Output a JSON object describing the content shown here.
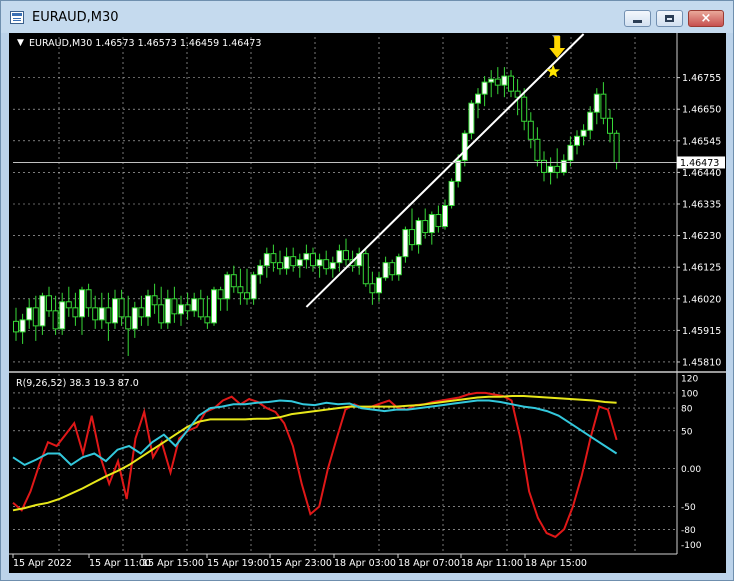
{
  "window": {
    "title": "EURAUD,M30",
    "buttons": {
      "minimize": "minimize-button",
      "maximize": "maximize-button",
      "close": "×"
    }
  },
  "chart_header": {
    "text": "EURAUD,M30  1.46573 1.46573 1.46459 1.46473",
    "dropdown_glyph": "▼"
  },
  "colors": {
    "background": "#000000",
    "grid": "#c8c8c8",
    "bull_candle": "#ffffff",
    "wick": "#38d838",
    "bid_line": "#c0c0c0",
    "trendline": "#ffffff",
    "arrow": "#ffd700",
    "star": "#ffe600",
    "line_red": "#e01818",
    "line_yellow": "#e8e81a",
    "line_cyan": "#33c8dc"
  },
  "price_axis": {
    "labels": [
      "1.46755",
      "1.46650",
      "1.46545",
      "1.46440",
      "1.46335",
      "1.46230",
      "1.46125",
      "1.46020",
      "1.45915",
      "1.45810"
    ],
    "current_price": "1.46473",
    "range": [
      1.4578,
      1.4689
    ]
  },
  "indicator": {
    "label": "R(9,26,52) 38.3 19.3 87.0",
    "axis_labels": [
      "120",
      "100",
      "80",
      "50",
      "0.00",
      "-50",
      "-80",
      "-100"
    ],
    "range": [
      -110,
      125
    ]
  },
  "time_axis": {
    "labels": [
      "15 Apr 2022",
      "15 Apr 11:00",
      "15 Apr 15:00",
      "15 Apr 19:00",
      "15 Apr 23:00",
      "18 Apr 03:00",
      "18 Apr 07:00",
      "18 Apr 11:00",
      "18 Apr 15:00"
    ]
  },
  "chart_data": {
    "type": "candlestick",
    "symbol": "EURAUD",
    "timeframe": "M30",
    "candles": [
      [
        1.45945,
        1.4599,
        1.4588,
        1.4591
      ],
      [
        1.4591,
        1.4597,
        1.4587,
        1.4595
      ],
      [
        1.4595,
        1.4602,
        1.4592,
        1.4599
      ],
      [
        1.4599,
        1.4603,
        1.4588,
        1.4593
      ],
      [
        1.4593,
        1.4604,
        1.459,
        1.4603
      ],
      [
        1.4603,
        1.4606,
        1.4596,
        1.4598
      ],
      [
        1.4598,
        1.4603,
        1.459,
        1.4592
      ],
      [
        1.4592,
        1.4604,
        1.459,
        1.4601
      ],
      [
        1.4601,
        1.4606,
        1.4596,
        1.4599
      ],
      [
        1.4599,
        1.4604,
        1.4593,
        1.4596
      ],
      [
        1.4596,
        1.4606,
        1.459,
        1.4605
      ],
      [
        1.4605,
        1.4607,
        1.4596,
        1.4599
      ],
      [
        1.4599,
        1.4603,
        1.4592,
        1.4595
      ],
      [
        1.4595,
        1.4604,
        1.4592,
        1.4599
      ],
      [
        1.4599,
        1.4604,
        1.4588,
        1.4594
      ],
      [
        1.4594,
        1.4605,
        1.4592,
        1.4602
      ],
      [
        1.4602,
        1.4605,
        1.4593,
        1.4596
      ],
      [
        1.4596,
        1.4603,
        1.4583,
        1.4592
      ],
      [
        1.4592,
        1.4601,
        1.4589,
        1.4599
      ],
      [
        1.4599,
        1.4603,
        1.4593,
        1.4596
      ],
      [
        1.4596,
        1.4605,
        1.4593,
        1.4603
      ],
      [
        1.4603,
        1.4607,
        1.4597,
        1.46
      ],
      [
        1.46,
        1.4606,
        1.4592,
        1.4594
      ],
      [
        1.4594,
        1.4605,
        1.4592,
        1.4602
      ],
      [
        1.4602,
        1.4606,
        1.4594,
        1.4597
      ],
      [
        1.4597,
        1.4603,
        1.4593,
        1.46
      ],
      [
        1.46,
        1.4604,
        1.4595,
        1.4598
      ],
      [
        1.4598,
        1.4604,
        1.4596,
        1.4602
      ],
      [
        1.4602,
        1.4605,
        1.4595,
        1.4596
      ],
      [
        1.4596,
        1.4603,
        1.4592,
        1.4594
      ],
      [
        1.4594,
        1.4606,
        1.4593,
        1.4605
      ],
      [
        1.4605,
        1.4606,
        1.4598,
        1.4602
      ],
      [
        1.4602,
        1.4611,
        1.4598,
        1.461
      ],
      [
        1.461,
        1.4613,
        1.4604,
        1.4606
      ],
      [
        1.4606,
        1.4612,
        1.46,
        1.4604
      ],
      [
        1.4604,
        1.4612,
        1.46,
        1.4602
      ],
      [
        1.4602,
        1.4611,
        1.46,
        1.461
      ],
      [
        1.461,
        1.4615,
        1.4607,
        1.4613
      ],
      [
        1.4613,
        1.4619,
        1.4609,
        1.4617
      ],
      [
        1.4617,
        1.462,
        1.4611,
        1.4614
      ],
      [
        1.4614,
        1.4618,
        1.461,
        1.4612
      ],
      [
        1.4612,
        1.4619,
        1.461,
        1.4616
      ],
      [
        1.4616,
        1.4619,
        1.4611,
        1.4613
      ],
      [
        1.4613,
        1.4617,
        1.4609,
        1.4615
      ],
      [
        1.4615,
        1.462,
        1.4612,
        1.4617
      ],
      [
        1.4617,
        1.4619,
        1.4611,
        1.4613
      ],
      [
        1.4613,
        1.4617,
        1.4609,
        1.4615
      ],
      [
        1.4615,
        1.4618,
        1.461,
        1.4612
      ],
      [
        1.4612,
        1.4616,
        1.4609,
        1.4614
      ],
      [
        1.4614,
        1.462,
        1.4611,
        1.4618
      ],
      [
        1.4618,
        1.4622,
        1.4613,
        1.4615
      ],
      [
        1.4615,
        1.4618,
        1.4611,
        1.4613
      ],
      [
        1.4613,
        1.4619,
        1.461,
        1.4617
      ],
      [
        1.4617,
        1.4619,
        1.4606,
        1.4607
      ],
      [
        1.4607,
        1.4611,
        1.46,
        1.4604
      ],
      [
        1.4604,
        1.4611,
        1.4601,
        1.4609
      ],
      [
        1.4609,
        1.4616,
        1.4608,
        1.4614
      ],
      [
        1.4614,
        1.4615,
        1.4608,
        1.461
      ],
      [
        1.461,
        1.4617,
        1.4608,
        1.4616
      ],
      [
        1.4616,
        1.4626,
        1.4614,
        1.4625
      ],
      [
        1.4625,
        1.4632,
        1.4618,
        1.462
      ],
      [
        1.462,
        1.4629,
        1.4617,
        1.4628
      ],
      [
        1.4628,
        1.4632,
        1.4622,
        1.4624
      ],
      [
        1.4624,
        1.4631,
        1.462,
        1.463
      ],
      [
        1.463,
        1.4633,
        1.4624,
        1.4626
      ],
      [
        1.4626,
        1.4635,
        1.4625,
        1.4633
      ],
      [
        1.4633,
        1.4642,
        1.4632,
        1.4641
      ],
      [
        1.4641,
        1.465,
        1.4639,
        1.4648
      ],
      [
        1.4648,
        1.4658,
        1.4646,
        1.4657
      ],
      [
        1.4657,
        1.4668,
        1.4655,
        1.4667
      ],
      [
        1.4667,
        1.4672,
        1.4662,
        1.467
      ],
      [
        1.467,
        1.4676,
        1.4666,
        1.4674
      ],
      [
        1.4674,
        1.4678,
        1.4669,
        1.4675
      ],
      [
        1.4675,
        1.4679,
        1.467,
        1.4673
      ],
      [
        1.4673,
        1.4679,
        1.4669,
        1.4676
      ],
      [
        1.4676,
        1.4678,
        1.4669,
        1.4671
      ],
      [
        1.4671,
        1.4675,
        1.4663,
        1.4669
      ],
      [
        1.4669,
        1.4672,
        1.4658,
        1.4661
      ],
      [
        1.4661,
        1.4664,
        1.4652,
        1.4655
      ],
      [
        1.4655,
        1.4659,
        1.4646,
        1.4648
      ],
      [
        1.4648,
        1.4651,
        1.4641,
        1.4644
      ],
      [
        1.4644,
        1.4649,
        1.464,
        1.4646
      ],
      [
        1.4646,
        1.4652,
        1.4642,
        1.4644
      ],
      [
        1.4644,
        1.465,
        1.4643,
        1.4648
      ],
      [
        1.4648,
        1.4656,
        1.4646,
        1.4653
      ],
      [
        1.4653,
        1.4658,
        1.465,
        1.4656
      ],
      [
        1.4656,
        1.466,
        1.4653,
        1.4658
      ],
      [
        1.4658,
        1.4666,
        1.4655,
        1.4664
      ],
      [
        1.4664,
        1.4672,
        1.466,
        1.467
      ],
      [
        1.467,
        1.4674,
        1.466,
        1.4662
      ],
      [
        1.4662,
        1.4665,
        1.4654,
        1.4657
      ],
      [
        1.4657,
        1.4658,
        1.4645,
        1.46473
      ]
    ],
    "trendline": {
      "from": [
        44,
        1.45993
      ],
      "to": [
        86,
        1.469
      ]
    },
    "signal_bar": 82,
    "indicator_series": [
      {
        "color": "red",
        "values": [
          -45,
          -55,
          -30,
          5,
          35,
          30,
          45,
          60,
          20,
          70,
          15,
          -20,
          10,
          -40,
          40,
          75,
          15,
          35,
          -5,
          40,
          50,
          55,
          75,
          80,
          90,
          95,
          85,
          92,
          88,
          80,
          75,
          60,
          30,
          -20,
          -60,
          -50,
          0,
          40,
          78,
          85,
          80,
          82,
          86,
          90,
          80,
          78,
          84,
          85,
          88,
          90,
          92,
          94,
          98,
          100,
          100,
          98,
          96,
          90,
          40,
          -30,
          -65,
          -85,
          -90,
          -80,
          -50,
          -10,
          40,
          82,
          78,
          38
        ]
      },
      {
        "color": "yellow",
        "values": [
          -55,
          -52,
          -48,
          -45,
          -40,
          -33,
          -26,
          -18,
          -10,
          -3,
          5,
          15,
          25,
          35,
          45,
          55,
          62,
          65,
          65,
          65,
          65,
          66,
          66,
          68,
          72,
          74,
          76,
          78,
          80,
          82,
          82,
          82,
          82,
          82,
          83,
          84,
          86,
          88,
          90,
          92,
          94,
          95,
          95,
          96,
          96,
          95,
          94,
          93,
          92,
          91,
          90,
          88,
          87
        ]
      },
      {
        "color": "cyan",
        "values": [
          15,
          5,
          12,
          20,
          20,
          5,
          15,
          20,
          10,
          25,
          30,
          20,
          35,
          45,
          30,
          50,
          70,
          80,
          82,
          85,
          85,
          87,
          88,
          90,
          89,
          85,
          84,
          87,
          85,
          86,
          80,
          78,
          76,
          78,
          78,
          80,
          82,
          84,
          86,
          88,
          90,
          90,
          88,
          85,
          82,
          80,
          76,
          70,
          60,
          50,
          40,
          30,
          20
        ]
      }
    ]
  }
}
